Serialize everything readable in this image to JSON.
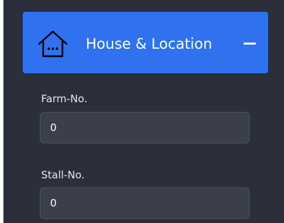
{
  "section": {
    "title": "House & Location",
    "icon": "house-icon",
    "collapse_icon": "minus-icon",
    "accent_color": "#2f71ee"
  },
  "fields": [
    {
      "label": "Farm-No.",
      "value": "0"
    },
    {
      "label": "Stall-No.",
      "value": "0"
    }
  ]
}
